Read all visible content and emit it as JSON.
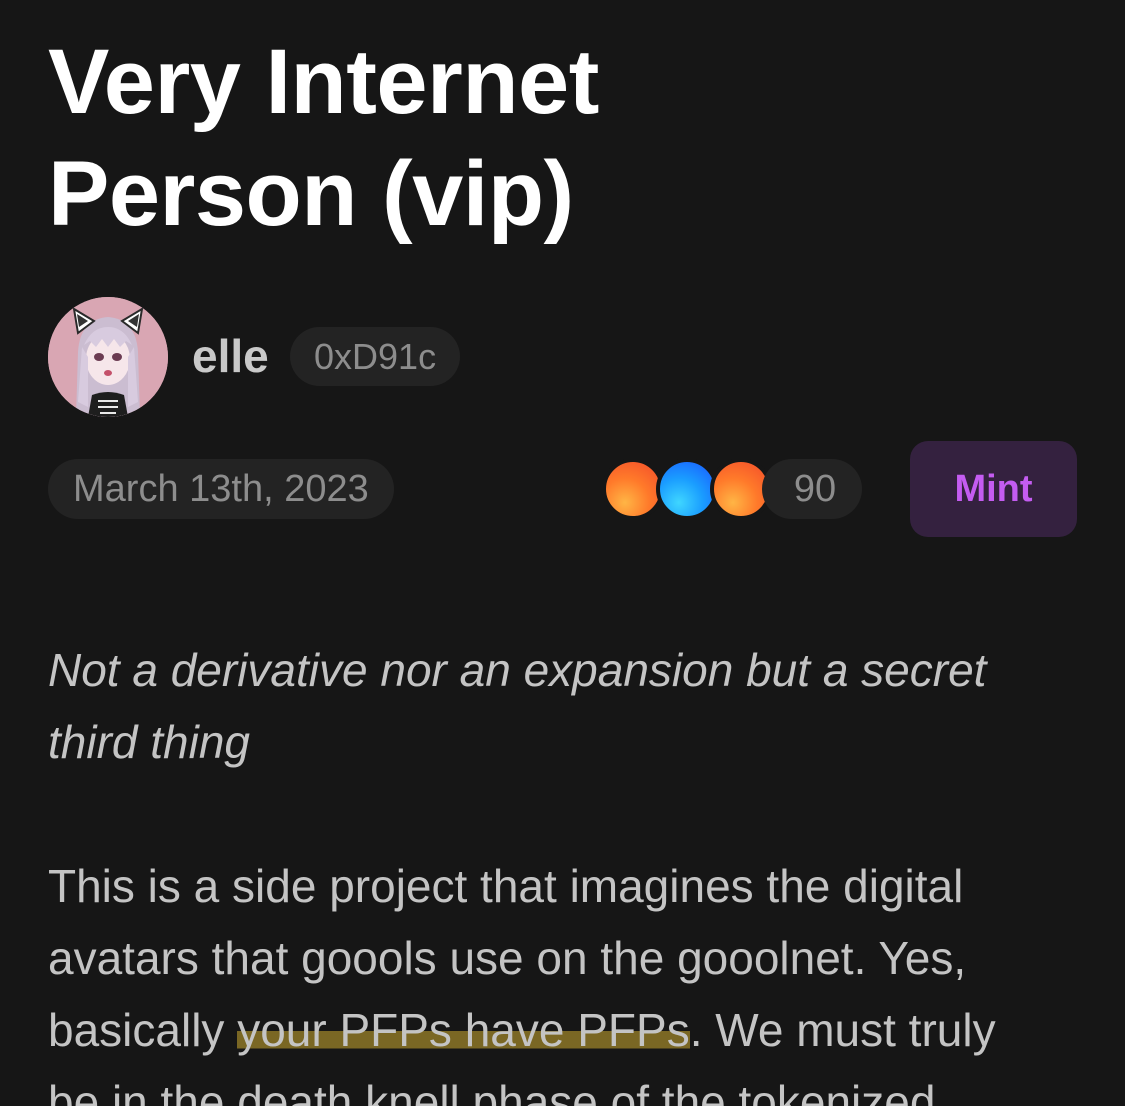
{
  "article": {
    "title_line_1": "Very Internet",
    "title_line_2": "Person (vip)",
    "subtitle": "Not a derivative nor an expansion but a secret third thing",
    "body": {
      "line_1": "This is a side project that imagines the digital",
      "line_2": "avatars that goools use on the gooolnet. Yes,",
      "line_3_before": "basically ",
      "line_3_highlight": "your PFPs have PFPs",
      "line_3_after": ". We must truly",
      "line_4": "be in the death knell phase of the tokenized"
    }
  },
  "author": {
    "name": "elle",
    "address": "0xD91c"
  },
  "meta": {
    "date": "March 13th, 2023",
    "collector_count": "90"
  },
  "actions": {
    "mint_label": "Mint"
  },
  "colors": {
    "background": "#161616",
    "mint_text": "#c45cf1",
    "mint_bg": "#34213f",
    "highlight": "#9b8228"
  }
}
